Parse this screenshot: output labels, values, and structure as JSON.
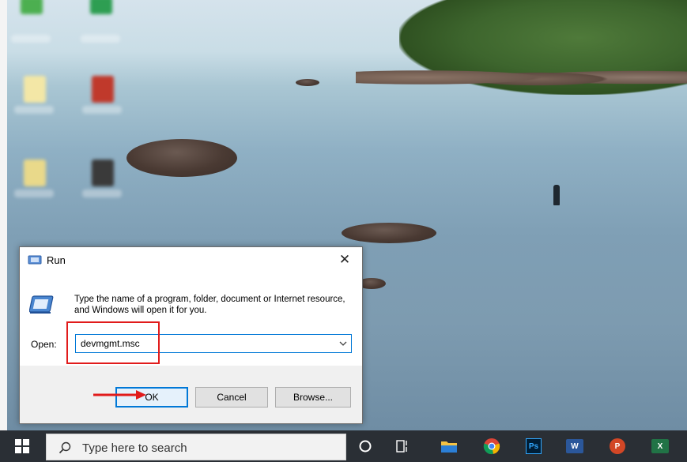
{
  "run_dialog": {
    "title": "Run",
    "close_glyph": "✕",
    "description": "Type the name of a program, folder, document or Internet resource, and Windows will open it for you.",
    "open_label": "Open:",
    "command_value": "devmgmt.msc",
    "buttons": {
      "ok": "OK",
      "cancel": "Cancel",
      "browse": "Browse..."
    }
  },
  "taskbar": {
    "search_placeholder": "Type here to search",
    "pinned_icons": [
      "cortana-circle-icon",
      "task-view-icon",
      "file-explorer-icon",
      "chrome-icon",
      "photoshop-icon",
      "word-icon",
      "powerpoint-icon",
      "excel-icon"
    ],
    "photoshop_label": "Ps",
    "word_label": "W",
    "powerpoint_label": "P",
    "excel_label": "X"
  },
  "colors": {
    "accent": "#0078d7",
    "annotation_red": "#e11b1b",
    "taskbar": "#2a2f35"
  }
}
